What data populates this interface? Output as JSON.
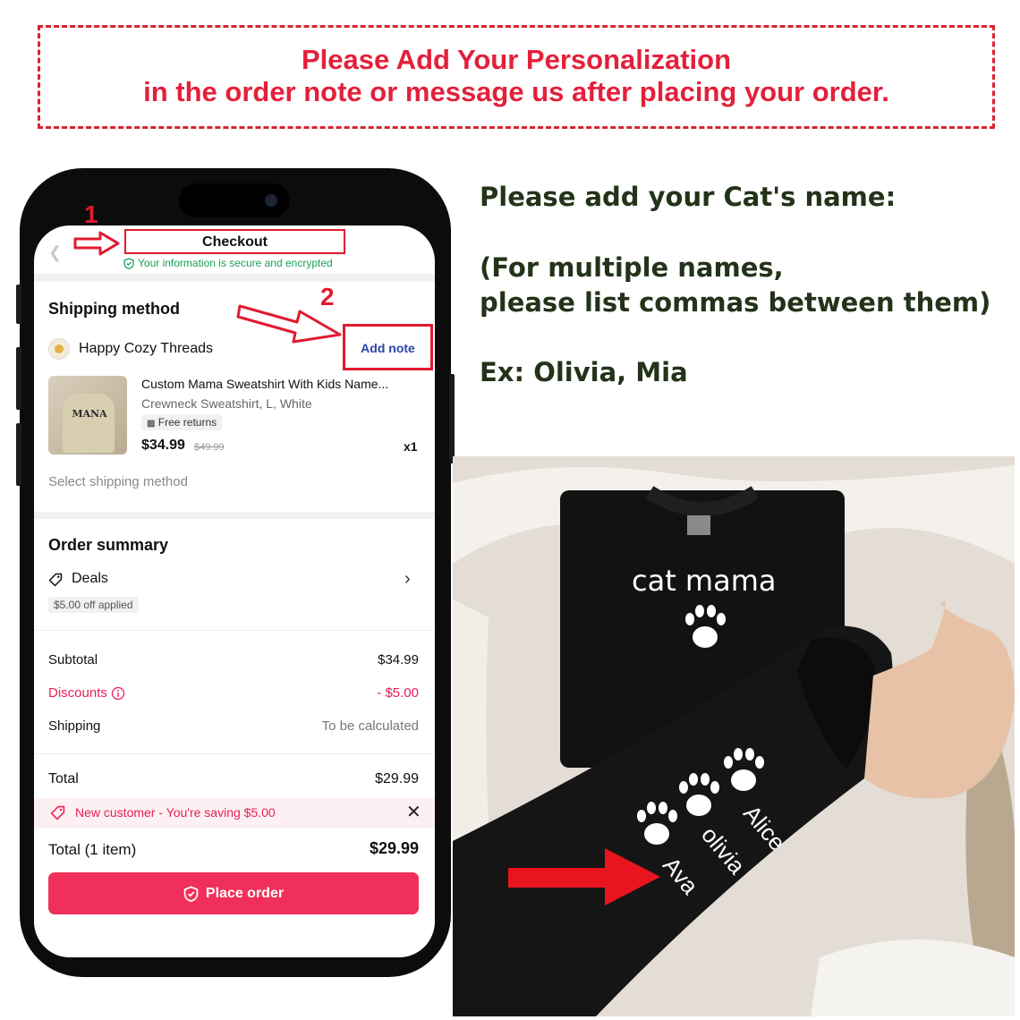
{
  "banner": {
    "line1": "Please Add Your Personalization",
    "line2": "in the order note or message us after placing your order."
  },
  "instructions": {
    "line1": "Please add your Cat's name:",
    "line2": "(For multiple names,",
    "line3": "please list commas between them)",
    "line4": "Ex: Olivia, Mia"
  },
  "phone": {
    "step1": "1",
    "step2": "2",
    "header": {
      "title": "Checkout",
      "secure_text": "Your information is secure and encrypted"
    },
    "shipping": {
      "section_title": "Shipping method",
      "shop_name": "Happy Cozy Threads",
      "add_note": "Add note",
      "product_title": "Custom Mama Sweatshirt With Kids Name...",
      "variant": "Crewneck Sweatshirt, L, White",
      "free_returns": "Free returns",
      "price": "$34.99",
      "original_price": "$49.99",
      "quantity": "x1",
      "thumb_text": "MANA",
      "select_method": "Select shipping method"
    },
    "summary": {
      "section_title": "Order summary",
      "deals_label": "Deals",
      "deals_badge": "$5.00 off applied",
      "subtotal_label": "Subtotal",
      "subtotal_value": "$34.99",
      "discounts_label": "Discounts",
      "discounts_value": "- $5.00",
      "shipping_label": "Shipping",
      "shipping_value": "To be calculated",
      "total_label": "Total",
      "total_value": "$29.99"
    },
    "promo": {
      "text": "New customer - You're saving $5.00"
    },
    "footer": {
      "total_label": "Total (1 item)",
      "total_value": "$29.99",
      "place_order": "Place order"
    }
  },
  "photo": {
    "front_print": "cat mama",
    "sleeve_names": [
      "Alice",
      "olivia",
      "Ava"
    ]
  },
  "colors": {
    "banner_red": "#e3203a",
    "instruction_green": "#233319",
    "accent_pink": "#f0305a",
    "secure_green": "#1a9e5a",
    "note_blue": "#2a44a8",
    "annotation_red": "#e01b2f"
  }
}
